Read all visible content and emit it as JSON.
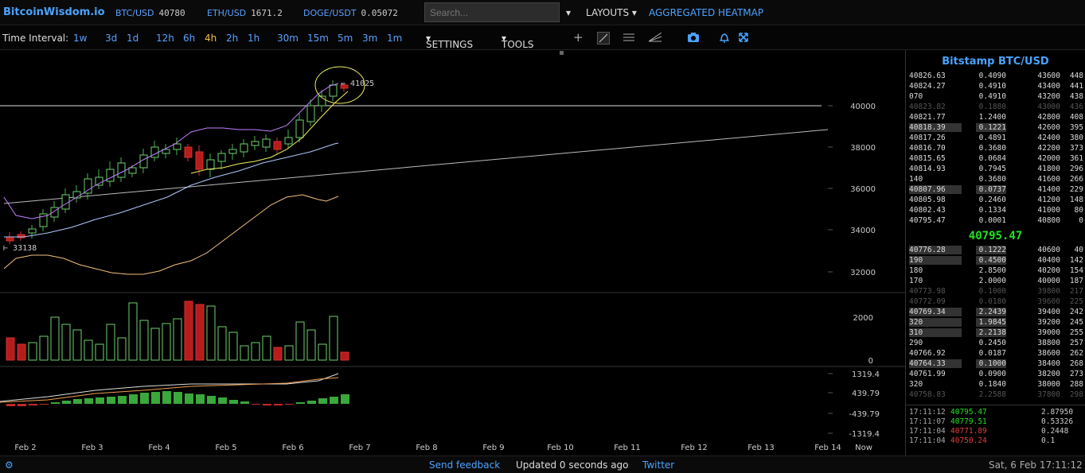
{
  "header": {
    "brand": "BitcoinWisdom.io",
    "tickers": [
      {
        "pair": "BTC/USD",
        "price": "40780"
      },
      {
        "pair": "ETH/USD",
        "price": "1671.2"
      },
      {
        "pair": "DOGE/USDT",
        "price": "0.05072"
      }
    ],
    "search_placeholder": "Search...",
    "layouts": "LAYOUTS",
    "heatmap": "AGGREGATED HEATMAP"
  },
  "toolbar": {
    "time_interval": "Time Interval:",
    "intervals": [
      "1w",
      "3d",
      "1d",
      "12h",
      "6h",
      "4h",
      "2h",
      "1h",
      "30m",
      "15m",
      "5m",
      "3m",
      "1m"
    ],
    "active_interval": "4h",
    "settings": "SETTINGS",
    "tools": "TOOLS"
  },
  "chart": {
    "price_axis": [
      "40000",
      "38000",
      "36000",
      "34000",
      "32000"
    ],
    "volume_axis": [
      "2000",
      "0"
    ],
    "macd_axis": [
      "1319.4",
      "439.79",
      "-439.79",
      "-1319.4"
    ],
    "date_axis": [
      "Feb 2",
      "Feb 3",
      "Feb 4",
      "Feb 5",
      "Feb 6",
      "Feb 7",
      "Feb 8",
      "Feb 9",
      "Feb 10",
      "Feb 11",
      "Feb 12",
      "Feb 13",
      "Feb 14",
      "Now"
    ],
    "high_label": "41025",
    "low_label": "33138"
  },
  "orderbook": {
    "title": "Bitstamp BTC/USD",
    "asks": [
      {
        "price": "40826.63",
        "amount": "0.4090",
        "cum": "43600",
        "total": "448",
        "dim": false,
        "hl": false
      },
      {
        "price": "40824.27",
        "amount": "0.4910",
        "cum": "43400",
        "total": "441",
        "dim": false,
        "hl": false
      },
      {
        "price": "070",
        "amount": "0.4910",
        "cum": "43200",
        "total": "438",
        "dim": false,
        "hl": false
      },
      {
        "price": "40823.82",
        "amount": "0.1880",
        "cum": "43000",
        "total": "436",
        "dim": true,
        "hl": false
      },
      {
        "price": "40821.77",
        "amount": "1.2400",
        "cum": "42800",
        "total": "408",
        "dim": false,
        "hl": false
      },
      {
        "price": "40818.39",
        "amount": "0.1221",
        "cum": "42600",
        "total": "395",
        "dim": false,
        "hl": true
      },
      {
        "price": "40817.26",
        "amount": "0.4891",
        "cum": "42400",
        "total": "380",
        "dim": false,
        "hl": false
      },
      {
        "price": "40816.70",
        "amount": "0.3680",
        "cum": "42200",
        "total": "373",
        "dim": false,
        "hl": false
      },
      {
        "price": "40815.65",
        "amount": "0.0684",
        "cum": "42000",
        "total": "361",
        "dim": false,
        "hl": false
      },
      {
        "price": "40814.93",
        "amount": "0.7945",
        "cum": "41800",
        "total": "296",
        "dim": false,
        "hl": false
      },
      {
        "price": "140",
        "amount": "0.3680",
        "cum": "41600",
        "total": "266",
        "dim": false,
        "hl": false
      },
      {
        "price": "40807.96",
        "amount": "0.0737",
        "cum": "41400",
        "total": "229",
        "dim": false,
        "hl": true
      },
      {
        "price": "40805.98",
        "amount": "0.2460",
        "cum": "41200",
        "total": "148",
        "dim": false,
        "hl": false
      },
      {
        "price": "40802.43",
        "amount": "0.1334",
        "cum": "41000",
        "total": "80",
        "dim": false,
        "hl": false
      },
      {
        "price": "40795.47",
        "amount": "0.0001",
        "cum": "40800",
        "total": "0",
        "dim": false,
        "hl": false
      }
    ],
    "last_price": "40795.47",
    "bids": [
      {
        "price": "40776.28",
        "amount": "0.1222",
        "cum": "40600",
        "total": "40",
        "dim": false,
        "hl": true
      },
      {
        "price": "190",
        "amount": "0.4500",
        "cum": "40400",
        "total": "142",
        "dim": false,
        "hl": true
      },
      {
        "price": "180",
        "amount": "2.8500",
        "cum": "40200",
        "total": "154",
        "dim": false,
        "hl": false
      },
      {
        "price": "170",
        "amount": "2.0000",
        "cum": "40000",
        "total": "187",
        "dim": false,
        "hl": false
      },
      {
        "price": "40773.98",
        "amount": "0.1000",
        "cum": "39800",
        "total": "217",
        "dim": true,
        "hl": false
      },
      {
        "price": "40772.09",
        "amount": "0.0180",
        "cum": "39600",
        "total": "225",
        "dim": true,
        "hl": false
      },
      {
        "price": "40769.34",
        "amount": "2.2439",
        "cum": "39400",
        "total": "242",
        "dim": false,
        "hl": true
      },
      {
        "price": "320",
        "amount": "1.9845",
        "cum": "39200",
        "total": "245",
        "dim": false,
        "hl": true
      },
      {
        "price": "310",
        "amount": "2.2138",
        "cum": "39000",
        "total": "255",
        "dim": false,
        "hl": true
      },
      {
        "price": "290",
        "amount": "0.2450",
        "cum": "38800",
        "total": "257",
        "dim": false,
        "hl": false
      },
      {
        "price": "40766.92",
        "amount": "0.0187",
        "cum": "38600",
        "total": "262",
        "dim": false,
        "hl": false
      },
      {
        "price": "40764.33",
        "amount": "0.1000",
        "cum": "38400",
        "total": "268",
        "dim": false,
        "hl": true
      },
      {
        "price": "40761.99",
        "amount": "0.0900",
        "cum": "38200",
        "total": "273",
        "dim": false,
        "hl": false
      },
      {
        "price": "320",
        "amount": "0.1840",
        "cum": "38000",
        "total": "288",
        "dim": false,
        "hl": false
      },
      {
        "price": "40758.83",
        "amount": "2.2588",
        "cum": "37800",
        "total": "298",
        "dim": true,
        "hl": false
      }
    ],
    "trades": [
      {
        "time": "17:11:12",
        "price": "40795.47",
        "amount": "2.87950",
        "color": "#22e022"
      },
      {
        "time": "17:11:07",
        "price": "40779.51",
        "amount": "0.53326",
        "color": "#22e022"
      },
      {
        "time": "17:11:04",
        "price": "40771.89",
        "amount": "0.2448",
        "color": "#e04040"
      },
      {
        "time": "17:11:04",
        "price": "40750.24",
        "amount": "0.1",
        "color": "#e04040"
      }
    ]
  },
  "footer": {
    "feedback": "Send feedback",
    "updated": "Updated 0 seconds ago",
    "twitter": "Twitter",
    "datetime": "Sat, 6 Feb 17:11:12"
  }
}
